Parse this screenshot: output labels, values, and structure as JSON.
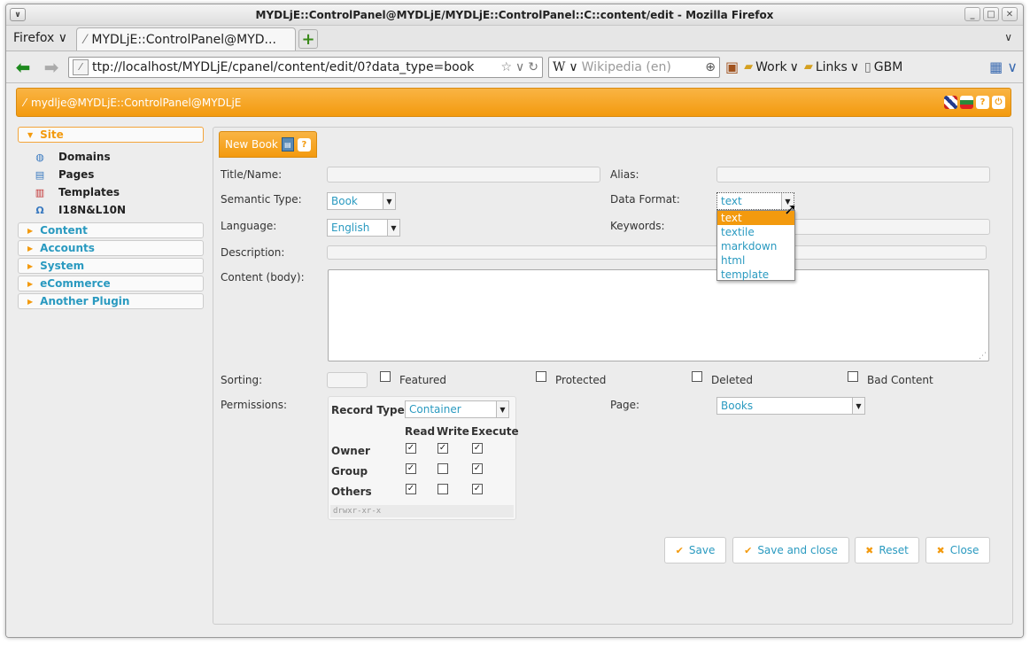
{
  "window": {
    "title": "MYDLjE::ControlPanel@MYDLjE/MYDLjE::ControlPanel::C::content/edit - Mozilla Firefox"
  },
  "browser": {
    "app_menu": "Firefox",
    "tab_title": "MYDLjE::ControlPanel@MYD...",
    "url": "ttp://localhost/MYDLjE/cpanel/content/edit/0?data_type=book",
    "search_placeholder": "Wikipedia (en)",
    "search_engine_glyph": "W",
    "bookmarks": [
      {
        "label": "Work",
        "icon": "folder-icon"
      },
      {
        "label": "Links",
        "icon": "folder-icon"
      },
      {
        "label": "GBM",
        "icon": "page-icon"
      }
    ]
  },
  "app": {
    "header_title": "mydlje@MYDLjE::ControlPanel@MYDLjE",
    "sidebar": {
      "sections": [
        {
          "label": "Site",
          "open": true,
          "items": [
            {
              "label": "Domains",
              "icon": "globe-icon"
            },
            {
              "label": "Pages",
              "icon": "page-icon"
            },
            {
              "label": "Templates",
              "icon": "template-icon"
            },
            {
              "label": "I18N&L10N",
              "icon": "omega-icon"
            }
          ]
        },
        {
          "label": "Content"
        },
        {
          "label": "Accounts"
        },
        {
          "label": "System"
        },
        {
          "label": "eCommerce"
        },
        {
          "label": "Another Plugin"
        }
      ]
    }
  },
  "form": {
    "tab_title": "New Book",
    "labels": {
      "title": "Title/Name:",
      "alias": "Alias:",
      "semantic_type": "Semantic Type:",
      "data_format": "Data Format:",
      "language": "Language:",
      "keywords": "Keywords:",
      "description": "Description:",
      "content": "Content (body):",
      "sorting": "Sorting:",
      "permissions": "Permissions:",
      "page": "Page:"
    },
    "values": {
      "semantic_type": "Book",
      "data_format": "text",
      "language": "English",
      "page": "Books"
    },
    "flags": {
      "featured": "Featured",
      "protected": "Protected",
      "deleted": "Deleted",
      "bad_content": "Bad Content"
    },
    "data_format_options": [
      "text",
      "textile",
      "markdown",
      "html",
      "template"
    ],
    "permissions": {
      "record_type_label": "Record Type",
      "record_type": "Container",
      "columns": [
        "Read",
        "Write",
        "Execute"
      ],
      "rows": [
        {
          "label": "Owner",
          "checks": [
            true,
            true,
            true
          ]
        },
        {
          "label": "Group",
          "checks": [
            true,
            false,
            true
          ]
        },
        {
          "label": "Others",
          "checks": [
            true,
            false,
            true
          ]
        }
      ],
      "octal": "drwxr-xr-x"
    },
    "buttons": {
      "save": "Save",
      "save_close": "Save and close",
      "reset": "Reset",
      "close": "Close"
    }
  }
}
